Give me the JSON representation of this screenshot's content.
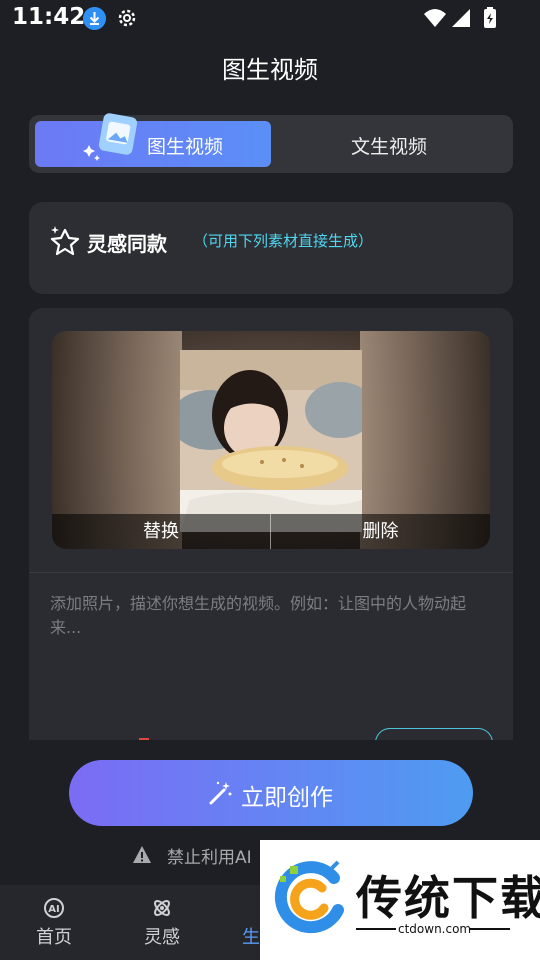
{
  "status_bar": {
    "time": "11:42"
  },
  "page_title": "图生视频",
  "tabs": [
    {
      "label": "图生视频",
      "active": true
    },
    {
      "label": "文生视频",
      "active": false
    }
  ],
  "inspiration": {
    "title": "灵感同款",
    "subtitle": "（可用下列素材直接生成）"
  },
  "upload": {
    "replace_label": "替换",
    "delete_label": "删除",
    "prompt_placeholder": "添加照片，描述你想生成的视频。例如：让图中的人物动起来..."
  },
  "cta": {
    "label": "立即创作"
  },
  "warning": {
    "text": "禁止利用AI"
  },
  "nav": [
    {
      "label": "首页",
      "icon": "ai-icon"
    },
    {
      "label": "灵感",
      "icon": "atom-icon"
    },
    {
      "label": "生",
      "icon": "generate-icon",
      "active": true
    }
  ],
  "watermark": {
    "brand": "传统下载",
    "url": "ctdown.com"
  },
  "colors": {
    "accent": "#5a9cf5",
    "cyan_text": "#4fd6f0",
    "background": "#1e1f24",
    "card": "#2d2e33"
  }
}
